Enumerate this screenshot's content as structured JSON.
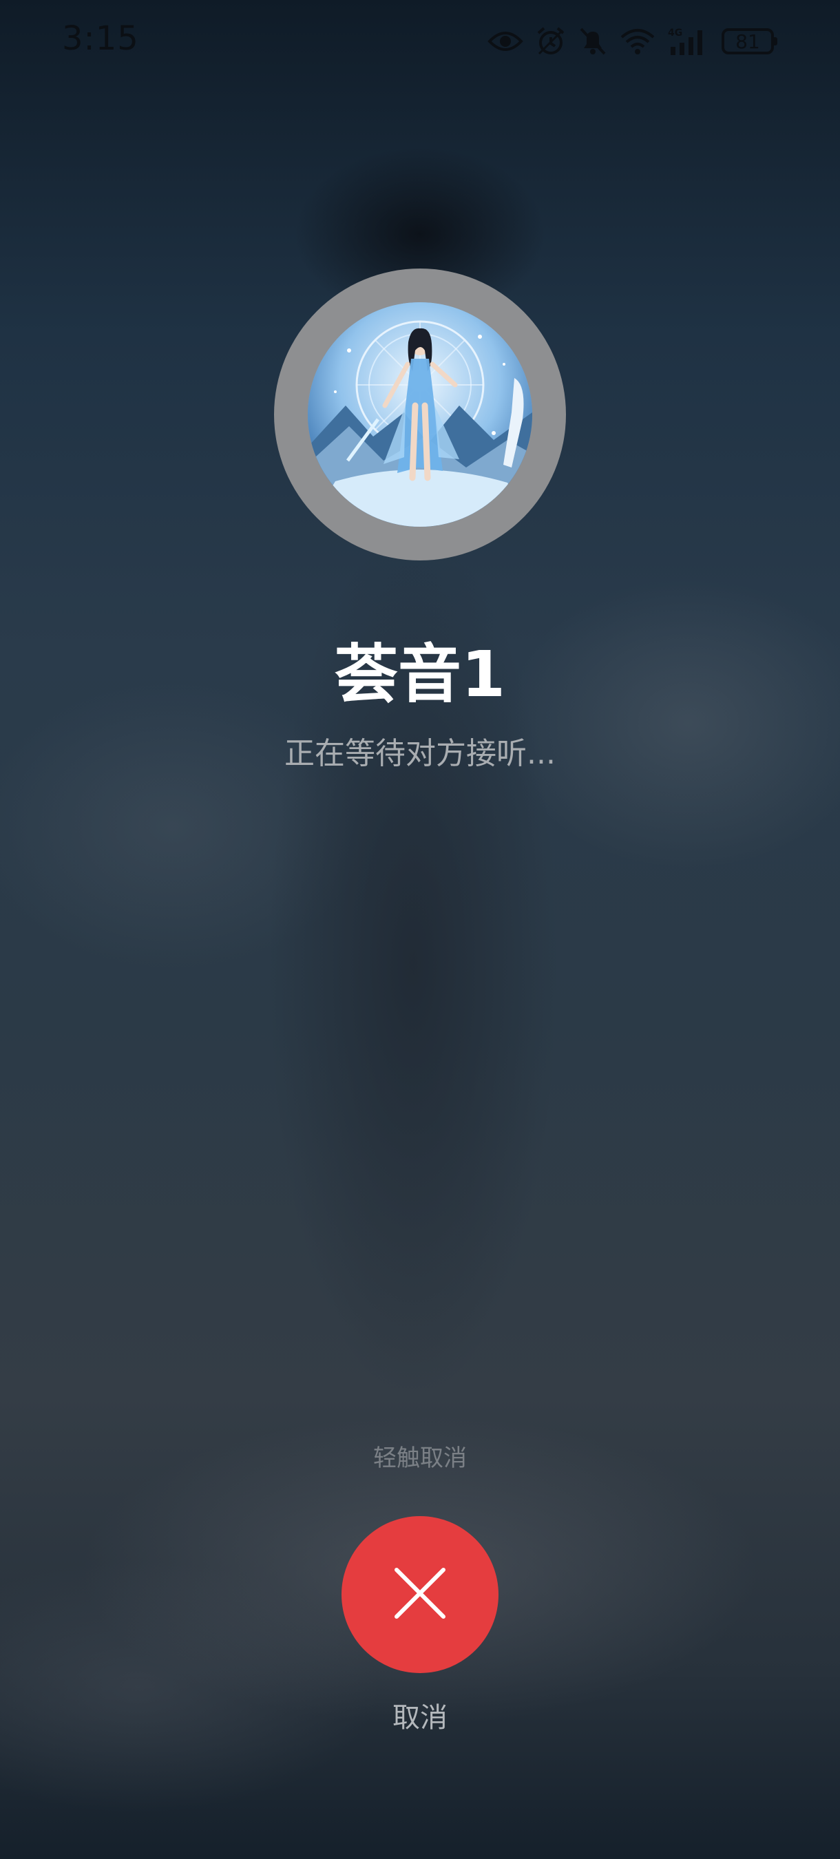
{
  "status_bar": {
    "time": "3:15",
    "battery_level": "81",
    "icons": [
      "eye-icon",
      "alarm-icon",
      "mute-bell-icon",
      "wifi-icon",
      "cellular-4g-icon",
      "battery-icon"
    ]
  },
  "call": {
    "caller_name": "荟音1",
    "status_text": "正在等待对方接听...",
    "tap_hint": "轻触取消",
    "cancel_label": "取消"
  },
  "colors": {
    "cancel_button": "#e53d3f",
    "avatar_ring": "#8e8f91"
  }
}
